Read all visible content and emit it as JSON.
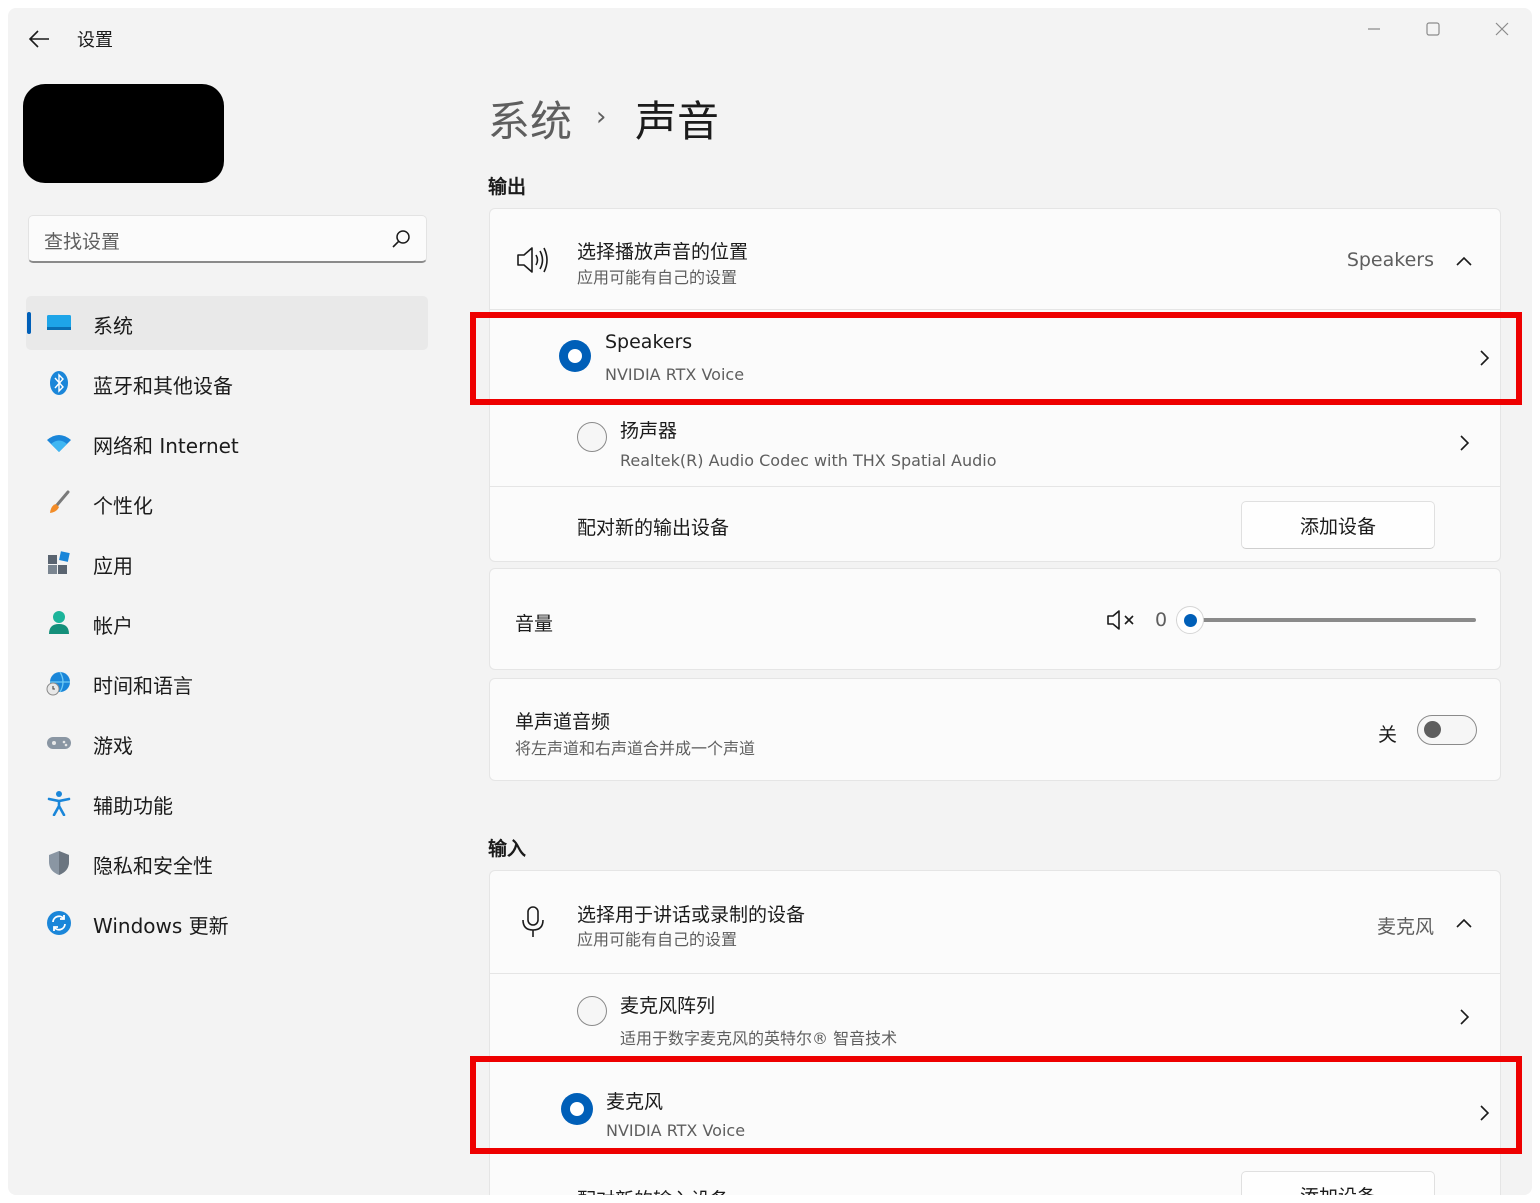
{
  "window": {
    "title": "设置",
    "controls": [
      "minimize",
      "maximize",
      "close"
    ]
  },
  "sidebar": {
    "search_placeholder": "查找设置",
    "items": [
      {
        "label": "系统",
        "icon": "system-display-icon",
        "active": true
      },
      {
        "label": "蓝牙和其他设备",
        "icon": "bluetooth-icon",
        "active": false
      },
      {
        "label": "网络和 Internet",
        "icon": "wifi-icon",
        "active": false
      },
      {
        "label": "个性化",
        "icon": "brush-icon",
        "active": false
      },
      {
        "label": "应用",
        "icon": "apps-icon",
        "active": false
      },
      {
        "label": "帐户",
        "icon": "account-icon",
        "active": false
      },
      {
        "label": "时间和语言",
        "icon": "globe-clock-icon",
        "active": false
      },
      {
        "label": "游戏",
        "icon": "gamepad-icon",
        "active": false
      },
      {
        "label": "辅助功能",
        "icon": "accessibility-icon",
        "active": false
      },
      {
        "label": "隐私和安全性",
        "icon": "shield-icon",
        "active": false
      },
      {
        "label": "Windows 更新",
        "icon": "windows-update-icon",
        "active": false
      }
    ]
  },
  "breadcrumb": {
    "parent": "系统",
    "separator": "›",
    "current": "声音"
  },
  "output": {
    "section_label": "输出",
    "selector": {
      "title": "选择播放声音的位置",
      "subtitle": "应用可能有自己的设置",
      "value": "Speakers"
    },
    "devices": [
      {
        "name": "Speakers",
        "detail": "NVIDIA RTX Voice",
        "selected": true
      },
      {
        "name": "扬声器",
        "detail": "Realtek(R) Audio Codec with THX Spatial Audio",
        "selected": false
      }
    ],
    "pair": {
      "label": "配对新的输出设备",
      "button": "添加设备"
    },
    "volume": {
      "label": "音量",
      "value": "0",
      "level": 0
    },
    "mono": {
      "title": "单声道音频",
      "subtitle": "将左声道和右声道合并成一个声道",
      "state": "关",
      "on": false
    }
  },
  "input": {
    "section_label": "输入",
    "selector": {
      "title": "选择用于讲话或录制的设备",
      "subtitle": "应用可能有自己的设置",
      "value": "麦克风"
    },
    "devices": [
      {
        "name": "麦克风阵列",
        "detail": "适用于数字麦克风的英特尔® 智音技术",
        "selected": false
      },
      {
        "name": "麦克风",
        "detail": "NVIDIA RTX Voice",
        "selected": true
      }
    ],
    "pair": {
      "label": "配对新的输入设备",
      "button": "添加设备"
    }
  },
  "colors": {
    "accent": "#005fb8",
    "highlight_box": "#ee0000",
    "background": "#f3f3f3",
    "card": "#fbfbfb"
  }
}
